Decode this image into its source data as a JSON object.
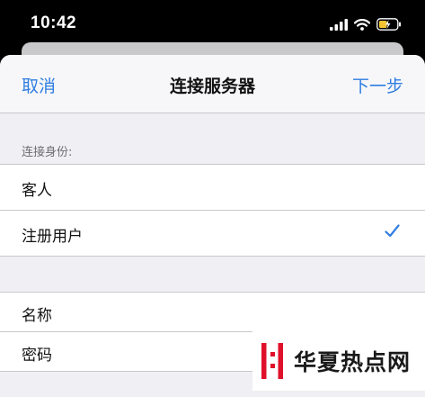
{
  "status_bar": {
    "time": "10:42",
    "icons": [
      "signal-icon",
      "wifi-icon",
      "battery-charging-icon"
    ],
    "battery_color": "#f4c430"
  },
  "nav": {
    "cancel_label": "取消",
    "title": "连接服务器",
    "next_label": "下一步"
  },
  "connect_as": {
    "label": "连接身份:",
    "options": [
      {
        "label": "客人",
        "selected": false
      },
      {
        "label": "注册用户",
        "selected": true
      }
    ]
  },
  "credentials": {
    "fields": [
      {
        "label": "名称"
      },
      {
        "label": "密码"
      }
    ]
  },
  "watermark": {
    "text": "华夏热点网",
    "logo_color": "#e0102a"
  },
  "colors": {
    "accent": "#2f7de1",
    "background": "#efeff4"
  }
}
